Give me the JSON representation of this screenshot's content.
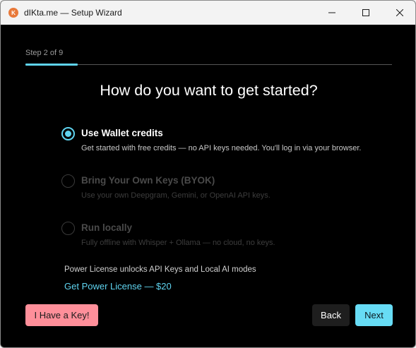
{
  "window": {
    "title": "dIKta.me — Setup Wizard",
    "app_icon_text": "K"
  },
  "wizard": {
    "step_label": "Step 2 of 9",
    "progress_fraction": 0.1429,
    "heading": "How do you want to get started?",
    "options": [
      {
        "title": "Use Wallet credits",
        "description": "Get started with free credits — no API keys needed. You'll log in via your browser.",
        "selected": true,
        "enabled": true
      },
      {
        "title": "Bring Your Own Keys (BYOK)",
        "description": "Use your own Deepgram, Gemini, or OpenAI API keys.",
        "selected": false,
        "enabled": false
      },
      {
        "title": "Run locally",
        "description": "Fully offline with Whisper + Ollama — no cloud, no keys.",
        "selected": false,
        "enabled": false
      }
    ],
    "license_note": "Power License unlocks API Keys and Local AI modes",
    "license_link": "Get Power License — $20",
    "buttons": {
      "have_key": "I Have a Key!",
      "back": "Back",
      "next": "Next"
    }
  },
  "colors": {
    "accent": "#5fd4f0",
    "key_button": "#ff8f9a",
    "background": "#000000"
  }
}
